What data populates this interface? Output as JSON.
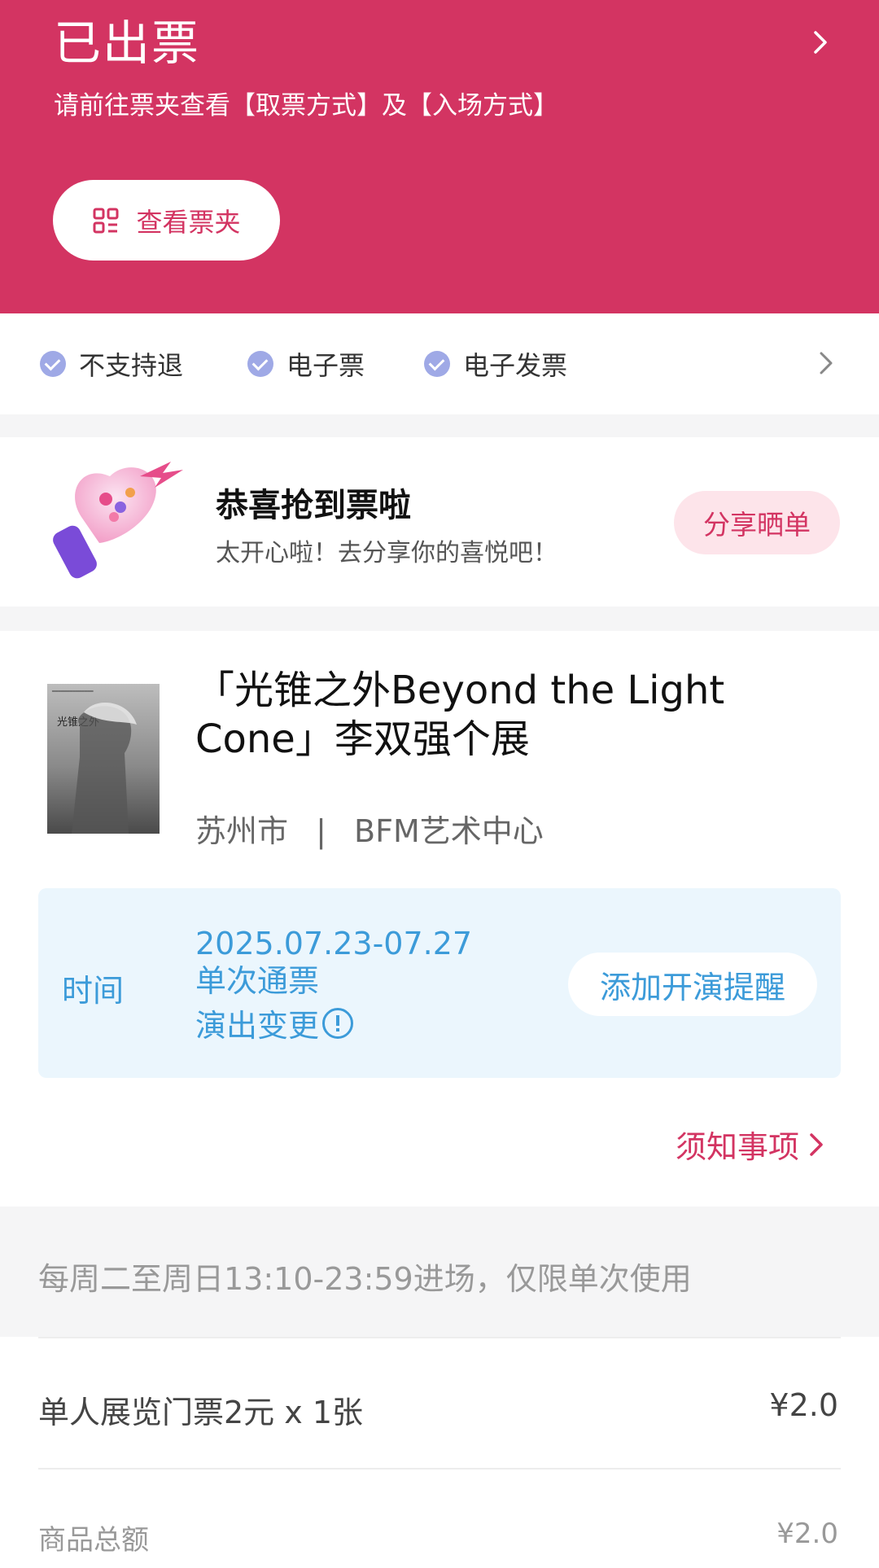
{
  "header": {
    "status": "已出票",
    "description": "请前往票夹查看【取票方式】及【入场方式】",
    "wallet_button": "查看票夹"
  },
  "features": {
    "items": [
      "不支持退",
      "电子票",
      "电子发票"
    ]
  },
  "share": {
    "title": "恭喜抢到票啦",
    "subtitle": "太开心啦！去分享你的喜悦吧！",
    "button": "分享晒单"
  },
  "event": {
    "title": "「光锥之外Beyond the Light Cone」李双强个展",
    "poster_title": "光锥之外",
    "city": "苏州市",
    "separator": "|",
    "venue": "BFM艺术中心",
    "time_label": "时间",
    "time_value": "2025.07.23-07.27 单次通票",
    "change_note": "演出变更",
    "remind_button": "添加开演提醒",
    "notice_link": "须知事项"
  },
  "entry_rule": "每周二至周日13:10-23:59进场，仅限单次使用",
  "order": {
    "item_label": "单人展览门票2元 x 1张",
    "item_price": "¥2.0",
    "total_label": "商品总额",
    "total_price": "¥2.0"
  },
  "colors": {
    "brand": "#d33462",
    "accent_blue": "#3c9bd9",
    "check_badge": "#9fa9e6"
  }
}
